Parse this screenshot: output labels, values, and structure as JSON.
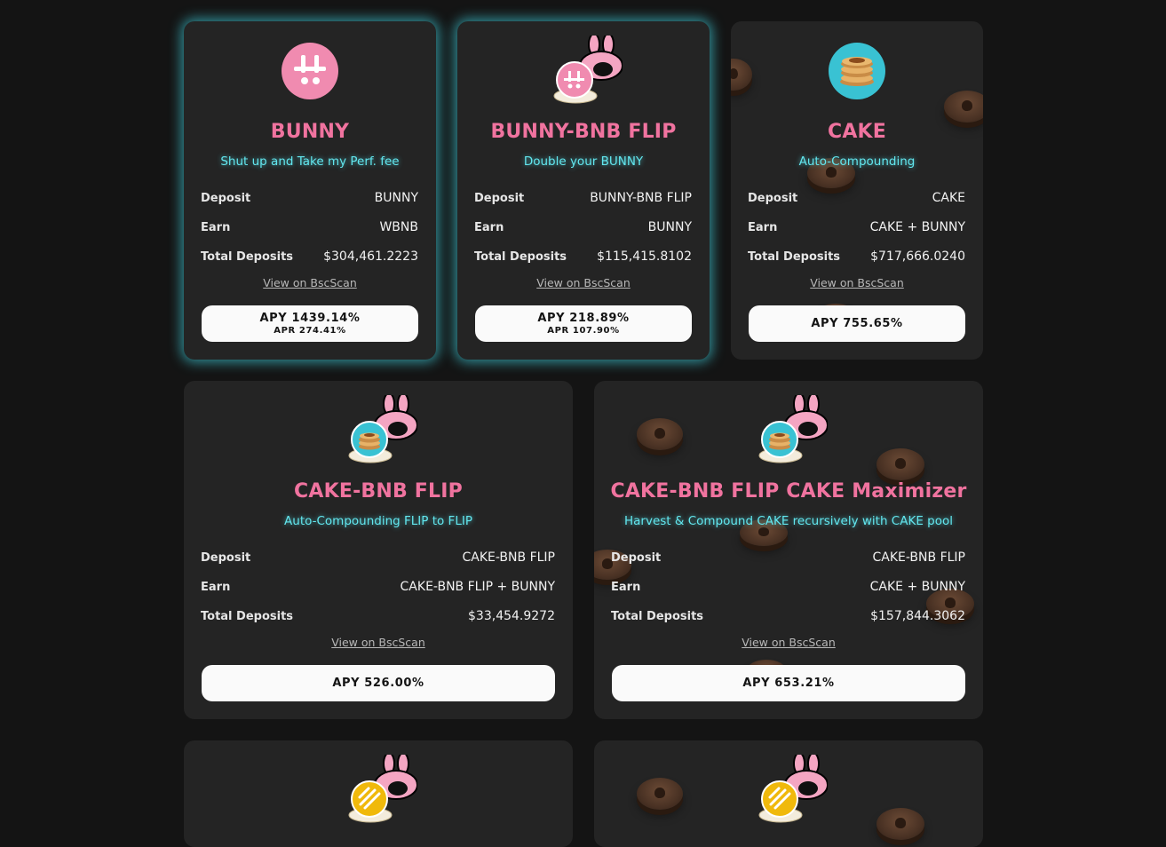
{
  "colors": {
    "background": "#141414",
    "card": "#242424",
    "title": "#f0739f",
    "subtitle": "#62e6ee",
    "glow": "#40d2e1",
    "button": "#fafafa"
  },
  "labels": {
    "deposit": "Deposit",
    "earn": "Earn",
    "total_deposits": "Total Deposits",
    "view_bscscan": "View on BscScan"
  },
  "pools": [
    {
      "icon": "bunny-token-icon",
      "title": "BUNNY",
      "subtitle": "Shut up and Take my Perf. fee",
      "deposit": "BUNNY",
      "earn": "WBNB",
      "total_deposits": "$304,461.2223",
      "apy": "APY 1439.14%",
      "apr": "APR 274.41%"
    },
    {
      "icon": "bunny-bnb-flip-icon",
      "title": "BUNNY-BNB FLIP",
      "subtitle": "Double your BUNNY",
      "deposit": "BUNNY-BNB FLIP",
      "earn": "BUNNY",
      "total_deposits": "$115,415.8102",
      "apy": "APY 218.89%",
      "apr": "APR 107.90%"
    },
    {
      "icon": "cake-token-icon",
      "title": "CAKE",
      "subtitle": "Auto-Compounding",
      "deposit": "CAKE",
      "earn": "CAKE + BUNNY",
      "total_deposits": "$717,666.0240",
      "apy": "APY 755.65%"
    },
    {
      "icon": "cake-bnb-flip-icon",
      "title": "CAKE-BNB FLIP",
      "subtitle": "Auto-Compounding FLIP to FLIP",
      "deposit": "CAKE-BNB FLIP",
      "earn": "CAKE-BNB FLIP + BUNNY",
      "total_deposits": "$33,454.9272",
      "apy": "APY 526.00%"
    },
    {
      "icon": "cake-bnb-flip-icon",
      "title": "CAKE-BNB FLIP CAKE Maximizer",
      "subtitle": "Harvest & Compound CAKE recursively with CAKE pool",
      "deposit": "CAKE-BNB FLIP",
      "earn": "CAKE + BUNNY",
      "total_deposits": "$157,844.3062",
      "apy": "APY 653.21%"
    },
    {
      "icon": "busd-flip-icon"
    },
    {
      "icon": "busd-flip-icon"
    }
  ]
}
